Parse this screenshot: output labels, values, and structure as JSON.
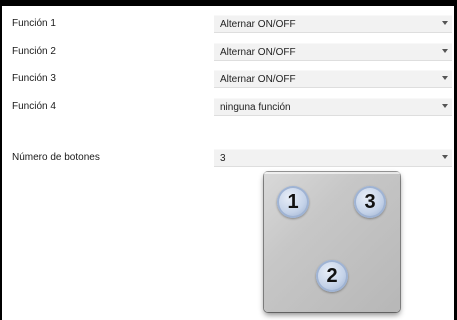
{
  "rows": [
    {
      "label": "Función 1",
      "value": "Alternar ON/OFF"
    },
    {
      "label": "Función 2",
      "value": "Alternar ON/OFF"
    },
    {
      "label": "Función 3",
      "value": "Alternar ON/OFF"
    },
    {
      "label": "Función 4",
      "value": "ninguna función"
    }
  ],
  "buttons_count": {
    "label": "Número de botones",
    "value": "3"
  },
  "pad": {
    "button_1": "1",
    "button_2": "2",
    "button_3": "3"
  },
  "icons": {
    "dropdown": "chevron-down-icon"
  }
}
